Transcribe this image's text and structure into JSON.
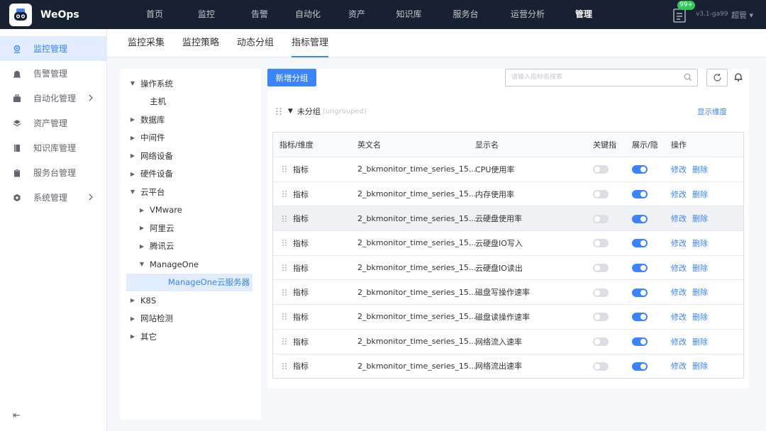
{
  "app": {
    "brand": "WeOps",
    "version": "v3.1-ga99",
    "user": "超管",
    "msg_badge": "99+"
  },
  "nav": [
    "首页",
    "监控",
    "告警",
    "自动化",
    "资产",
    "知识库",
    "服务台",
    "运营分析",
    "管理"
  ],
  "side": [
    {
      "label": "监控管理",
      "icon": "monitor-icon",
      "active": true
    },
    {
      "label": "告警管理",
      "icon": "alarm-icon"
    },
    {
      "label": "自动化管理",
      "icon": "briefcase-icon",
      "expand": true
    },
    {
      "label": "资产管理",
      "icon": "layers-icon"
    },
    {
      "label": "知识库管理",
      "icon": "book-icon"
    },
    {
      "label": "服务台管理",
      "icon": "clipboard-icon"
    },
    {
      "label": "系统管理",
      "icon": "gear-icon",
      "expand": true
    }
  ],
  "tabs": [
    "监控采集",
    "监控策略",
    "动态分组",
    "指标管理"
  ],
  "tree": [
    {
      "label": "操作系统",
      "level": 0,
      "open": true
    },
    {
      "label": "主机",
      "level": 1,
      "leaf": true
    },
    {
      "label": "数据库",
      "level": 0
    },
    {
      "label": "中间件",
      "level": 0
    },
    {
      "label": "网络设备",
      "level": 0
    },
    {
      "label": "硬件设备",
      "level": 0
    },
    {
      "label": "云平台",
      "level": 0,
      "open": true
    },
    {
      "label": "VMware",
      "level": 1
    },
    {
      "label": "阿里云",
      "level": 1
    },
    {
      "label": "腾讯云",
      "level": 1
    },
    {
      "label": "ManageOne",
      "level": 1,
      "open": true
    },
    {
      "label": "ManageOne云服务器",
      "level": 2,
      "leaf": true,
      "selected": true
    },
    {
      "label": "K8S",
      "level": 0
    },
    {
      "label": "网站检测",
      "level": 0
    },
    {
      "label": "其它",
      "level": 0
    }
  ],
  "toolbar": {
    "new_group": "新增分组",
    "search_placeholder": "请输入指标名搜索"
  },
  "group": {
    "title": "未分组",
    "sub": "(ungrouped)",
    "show_dim": "显示维度"
  },
  "table": {
    "headers": [
      "指标/维度",
      "英文名",
      "显示名",
      "关键指",
      "展示/隐",
      "操作"
    ],
    "ops": [
      "修改",
      "删除"
    ],
    "rows": [
      {
        "type": "指标",
        "en": "2_bkmonitor_time_series_15...",
        "name": "CPU使用率",
        "key": false,
        "show": true
      },
      {
        "type": "指标",
        "en": "2_bkmonitor_time_series_15...",
        "name": "内存使用率",
        "key": false,
        "show": true
      },
      {
        "type": "指标",
        "en": "2_bkmonitor_time_series_15...",
        "name": "云硬盘使用率",
        "key": false,
        "show": true
      },
      {
        "type": "指标",
        "en": "2_bkmonitor_time_series_15...",
        "name": "云硬盘IO写入",
        "key": false,
        "show": true
      },
      {
        "type": "指标",
        "en": "2_bkmonitor_time_series_15...",
        "name": "云硬盘IO读出",
        "key": false,
        "show": true
      },
      {
        "type": "指标",
        "en": "2_bkmonitor_time_series_15...",
        "name": "磁盘写操作速率",
        "key": false,
        "show": true
      },
      {
        "type": "指标",
        "en": "2_bkmonitor_time_series_15...",
        "name": "磁盘读操作速率",
        "key": false,
        "show": true
      },
      {
        "type": "指标",
        "en": "2_bkmonitor_time_series_15...",
        "name": "网络流入速率",
        "key": false,
        "show": true
      },
      {
        "type": "指标",
        "en": "2_bkmonitor_time_series_15...",
        "name": "网络流出速率",
        "key": false,
        "show": true
      }
    ]
  },
  "colors": {
    "accent": "#3a84ff",
    "topbar": "#182132",
    "badge": "#2dcb56"
  }
}
